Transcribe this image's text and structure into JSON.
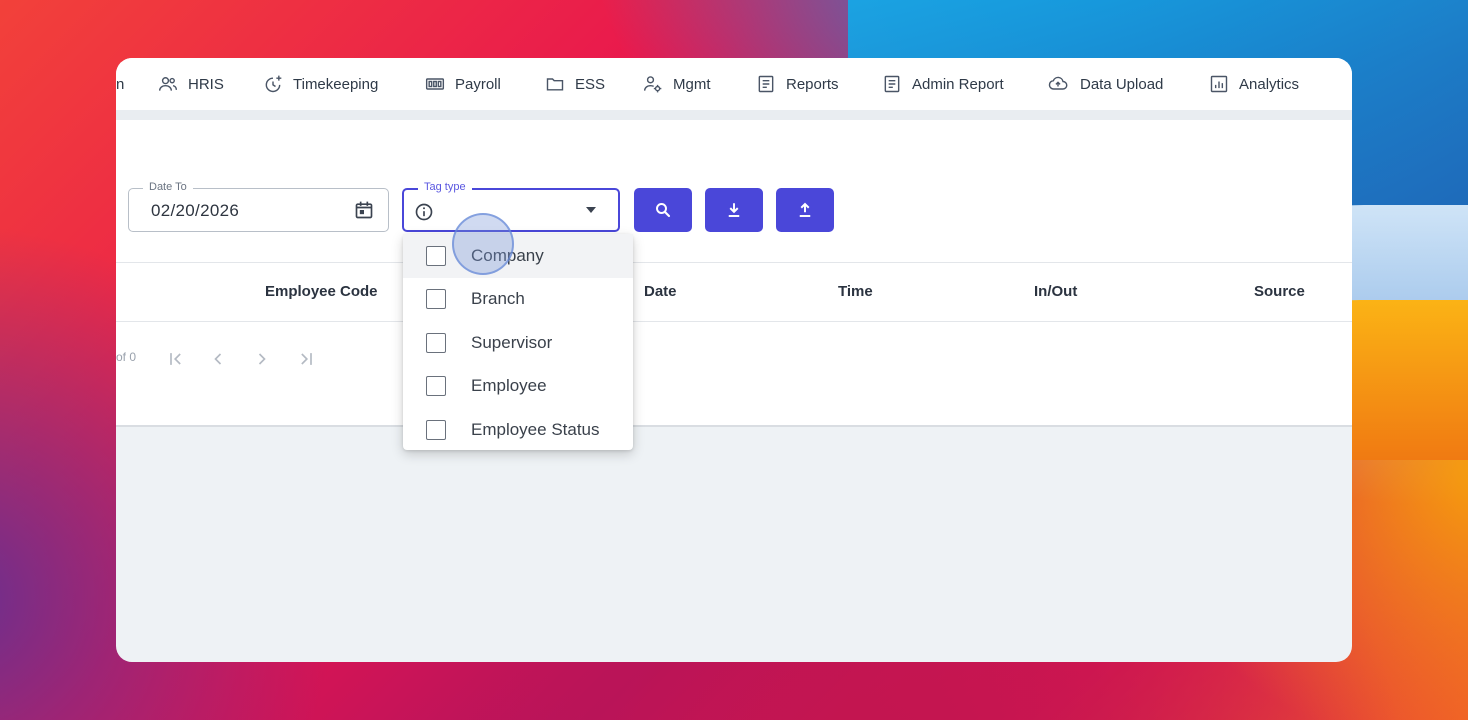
{
  "nav": {
    "cut_label": "n",
    "items": [
      {
        "label": "HRIS",
        "icon": "users-icon"
      },
      {
        "label": "Timekeeping",
        "icon": "clock-plus-icon"
      },
      {
        "label": "Payroll",
        "icon": "money-icon"
      },
      {
        "label": "ESS",
        "icon": "folder-icon"
      },
      {
        "label": "Mgmt",
        "icon": "user-gear-icon"
      },
      {
        "label": "Reports",
        "icon": "document-icon"
      },
      {
        "label": "Admin Report",
        "icon": "document-icon"
      },
      {
        "label": "Data Upload",
        "icon": "cloud-upload-icon"
      },
      {
        "label": "Analytics",
        "icon": "bar-chart-icon"
      }
    ]
  },
  "filters": {
    "date_to_label": "Date To",
    "date_to_value": "02/20/2026",
    "tag_type_label": "Tag type"
  },
  "buttons": {
    "search": "search-icon",
    "download": "download-icon",
    "upload": "upload-icon"
  },
  "table": {
    "headers": [
      "Employee Code",
      "Date",
      "Time",
      "In/Out",
      "Source"
    ]
  },
  "pager": {
    "of_text": "of 0"
  },
  "dropdown": {
    "options": [
      "Company",
      "Branch",
      "Supervisor",
      "Employee",
      "Employee Status"
    ],
    "hovered_index": 0
  },
  "colors": {
    "accent": "#4a47d9",
    "text": "#2f3a48"
  }
}
